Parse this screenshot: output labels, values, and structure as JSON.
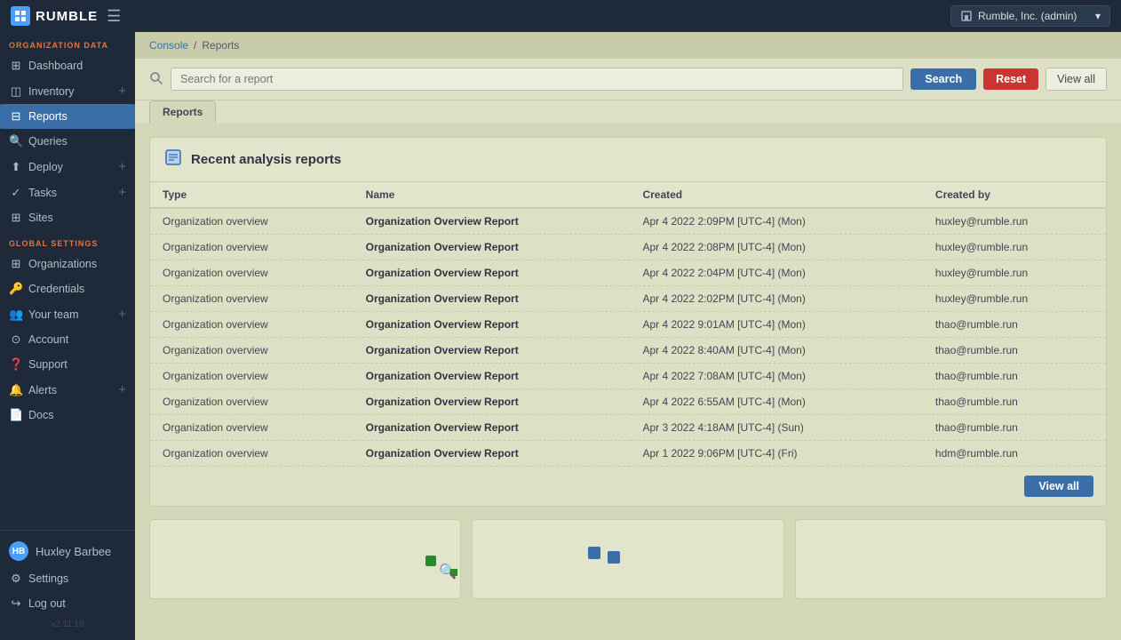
{
  "topbar": {
    "logo_text": "RUMBLE",
    "org_label": "Rumble, Inc. (admin)",
    "hamburger": "☰"
  },
  "sidebar": {
    "org_data_label": "ORGANIZATION DATA",
    "global_settings_label": "GLOBAL SETTINGS",
    "items_org": [
      {
        "id": "dashboard",
        "label": "Dashboard",
        "icon": "⊞",
        "has_plus": false
      },
      {
        "id": "inventory",
        "label": "Inventory",
        "icon": "◫",
        "has_plus": true
      },
      {
        "id": "reports",
        "label": "Reports",
        "icon": "⊟",
        "has_plus": false,
        "active": true
      },
      {
        "id": "queries",
        "label": "Queries",
        "icon": "🔍",
        "has_plus": false
      },
      {
        "id": "deploy",
        "label": "Deploy",
        "icon": "⬆",
        "has_plus": true
      },
      {
        "id": "tasks",
        "label": "Tasks",
        "icon": "✓",
        "has_plus": true
      },
      {
        "id": "sites",
        "label": "Sites",
        "icon": "⊞",
        "has_plus": false
      }
    ],
    "items_global": [
      {
        "id": "organizations",
        "label": "Organizations",
        "icon": "⊞",
        "has_plus": false
      },
      {
        "id": "credentials",
        "label": "Credentials",
        "icon": "🔑",
        "has_plus": false
      },
      {
        "id": "your-team",
        "label": "Your team",
        "icon": "👥",
        "has_plus": true
      },
      {
        "id": "account",
        "label": "Account",
        "icon": "⊙",
        "has_plus": false
      },
      {
        "id": "support",
        "label": "Support",
        "icon": "❓",
        "has_plus": false
      },
      {
        "id": "alerts",
        "label": "Alerts",
        "icon": "🔔",
        "has_plus": true
      },
      {
        "id": "docs",
        "label": "Docs",
        "icon": "📄",
        "has_plus": false
      }
    ],
    "user_name": "Huxley Barbee",
    "settings_label": "Settings",
    "logout_label": "Log out",
    "version": "v2.11.19"
  },
  "breadcrumb": {
    "console": "Console",
    "separator": "/",
    "current": "Reports"
  },
  "search": {
    "placeholder": "Search for a report",
    "button_label": "Search",
    "reset_label": "Reset",
    "view_all_label": "View all"
  },
  "tab": {
    "label": "Reports"
  },
  "reports": {
    "section_title": "Recent analysis reports",
    "columns": [
      "Type",
      "Name",
      "Created",
      "Created by"
    ],
    "view_all_label": "View all",
    "rows": [
      {
        "type": "Organization overview",
        "name": "Organization Overview Report",
        "created": "Apr 4 2022 2:09PM [UTC-4] (Mon)",
        "created_by": "huxley@rumble.run"
      },
      {
        "type": "Organization overview",
        "name": "Organization Overview Report",
        "created": "Apr 4 2022 2:08PM [UTC-4] (Mon)",
        "created_by": "huxley@rumble.run"
      },
      {
        "type": "Organization overview",
        "name": "Organization Overview Report",
        "created": "Apr 4 2022 2:04PM [UTC-4] (Mon)",
        "created_by": "huxley@rumble.run"
      },
      {
        "type": "Organization overview",
        "name": "Organization Overview Report",
        "created": "Apr 4 2022 2:02PM [UTC-4] (Mon)",
        "created_by": "huxley@rumble.run"
      },
      {
        "type": "Organization overview",
        "name": "Organization Overview Report",
        "created": "Apr 4 2022 9:01AM [UTC-4] (Mon)",
        "created_by": "thao@rumble.run"
      },
      {
        "type": "Organization overview",
        "name": "Organization Overview Report",
        "created": "Apr 4 2022 8:40AM [UTC-4] (Mon)",
        "created_by": "thao@rumble.run"
      },
      {
        "type": "Organization overview",
        "name": "Organization Overview Report",
        "created": "Apr 4 2022 7:08AM [UTC-4] (Mon)",
        "created_by": "thao@rumble.run"
      },
      {
        "type": "Organization overview",
        "name": "Organization Overview Report",
        "created": "Apr 4 2022 6:55AM [UTC-4] (Mon)",
        "created_by": "thao@rumble.run"
      },
      {
        "type": "Organization overview",
        "name": "Organization Overview Report",
        "created": "Apr 3 2022 4:18AM [UTC-4] (Sun)",
        "created_by": "thao@rumble.run"
      },
      {
        "type": "Organization overview",
        "name": "Organization Overview Report",
        "created": "Apr 1 2022 9:06PM [UTC-4] (Fri)",
        "created_by": "hdm@rumble.run"
      }
    ]
  }
}
